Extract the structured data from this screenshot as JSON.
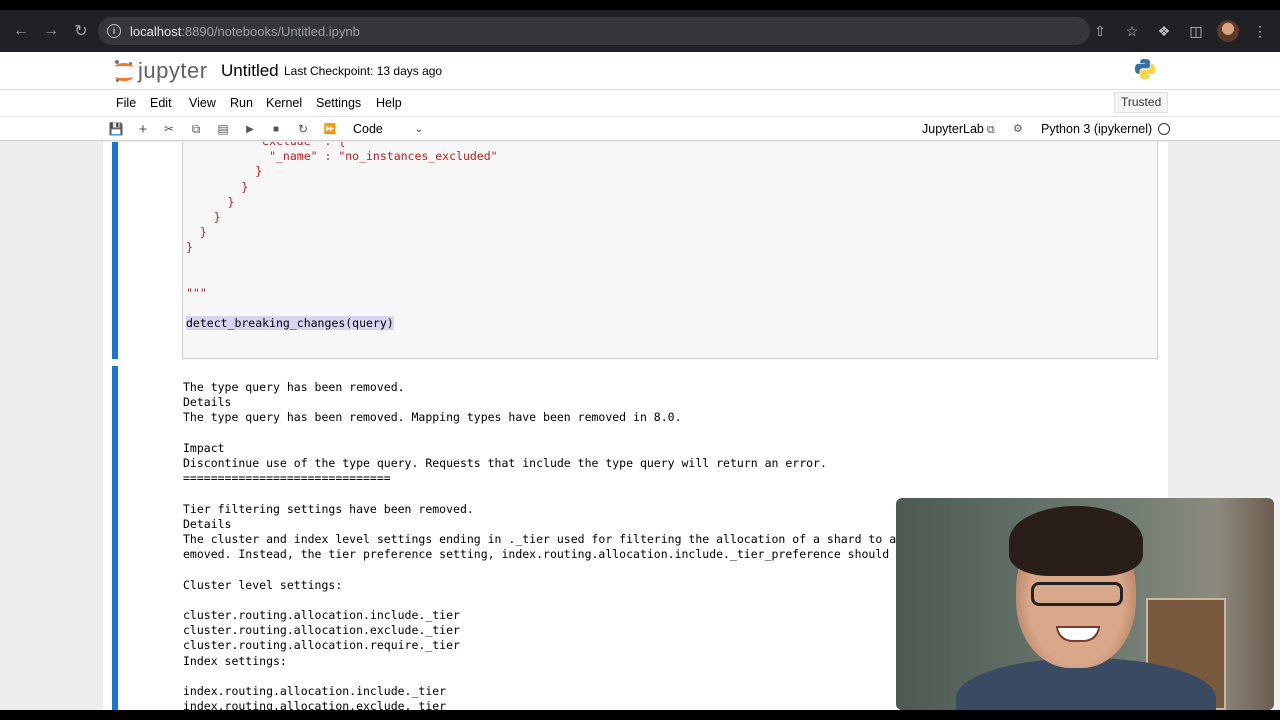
{
  "browser": {
    "url_host": "localhost",
    "url_rest": ":8890/notebooks/Untitled.ipynb"
  },
  "header": {
    "logo_text": "jupyter",
    "notebook_title": "Untitled",
    "checkpoint": "Last Checkpoint: 13 days ago"
  },
  "menu": {
    "items": [
      "File",
      "Edit",
      "View",
      "Run",
      "Kernel",
      "Settings",
      "Help"
    ],
    "trusted": "Trusted"
  },
  "toolbar": {
    "cell_type": "Code",
    "jupyterlab": "JupyterLab",
    "kernel": "Python 3 (ipykernel)"
  },
  "cell_input": {
    "lines": [
      "          \"exclude\" : {",
      "            \"_name\" : \"no_instances_excluded\"",
      "          }",
      "        }",
      "      }",
      "    }",
      "  }",
      "}",
      "",
      "",
      "\"\"\"",
      "",
      "detect_breaking_changes(query)"
    ]
  },
  "cell_output": {
    "text": "The type query has been removed.\nDetails\nThe type query has been removed. Mapping types have been removed in 8.0.\n\nImpact\nDiscontinue use of the type query. Requests that include the type query will return an error.\n==============================\n\nTier filtering settings have been removed.\nDetails\nThe cluster and index level settings ending in ._tier used for filtering the allocation of a shard to a\nemoved. Instead, the tier preference setting, index.routing.allocation.include._tier_preference should\n\nCluster level settings:\n\ncluster.routing.allocation.include._tier\ncluster.routing.allocation.exclude._tier\ncluster.routing.allocation.require._tier\nIndex settings:\n\nindex.routing.allocation.include._tier\nindex.routing.allocation.exclude._tier"
  }
}
